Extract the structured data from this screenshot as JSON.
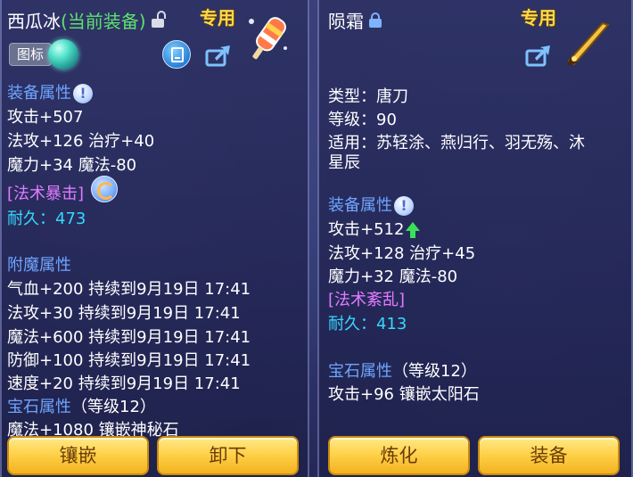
{
  "left_panel": {
    "title_name": "西瓜冰",
    "title_status": "(当前装备)",
    "exclusive_label": "专用",
    "badge_label": "图标",
    "section_equip_attr": "装备属性",
    "stats": [
      "攻击+507",
      "法攻+126 治疗+40",
      "魔力+34 魔法-80"
    ],
    "skill": "[法术暴击]",
    "durability": "耐久：473",
    "section_enchant": "附魔属性",
    "enchants": [
      "气血+200 持续到9月19日 17:41",
      "法攻+30 持续到9月19日 17:41",
      "魔法+600 持续到9月19日 17:41",
      "防御+100 持续到9月19日 17:41",
      "速度+20 持续到9月19日 17:41"
    ],
    "section_gem": "宝石属性",
    "gem_level": "（等级12）",
    "gem_line": "魔法+1080 镶嵌神秘石",
    "buttons": {
      "inlay": "镶嵌",
      "unequip": "卸下"
    }
  },
  "right_panel": {
    "title_name": "陨霜",
    "exclusive_label": "专用",
    "type_line": "类型：唐刀",
    "level_line": "等级：90",
    "fit_line1": "适用：苏轻涂、燕归行、羽无殇、沐",
    "fit_line2": "星辰",
    "section_equip_attr": "装备属性",
    "stats": [
      "攻击+512",
      "法攻+128 治疗+45",
      "魔力+32 魔法-80"
    ],
    "skill": "[法术紊乱]",
    "durability": "耐久：413",
    "section_gem": "宝石属性",
    "gem_level": "（等级12）",
    "gem_line": "攻击+96 镶嵌太阳石",
    "buttons": {
      "refine": "炼化",
      "equip": "装备"
    }
  },
  "colors": {
    "section_blue": "#6fa5ff",
    "exclusive_gold": "#ffd84a",
    "status_green": "#5ee06f",
    "skill_magenta": "#e27bff",
    "durability_cyan": "#36d8ff"
  }
}
